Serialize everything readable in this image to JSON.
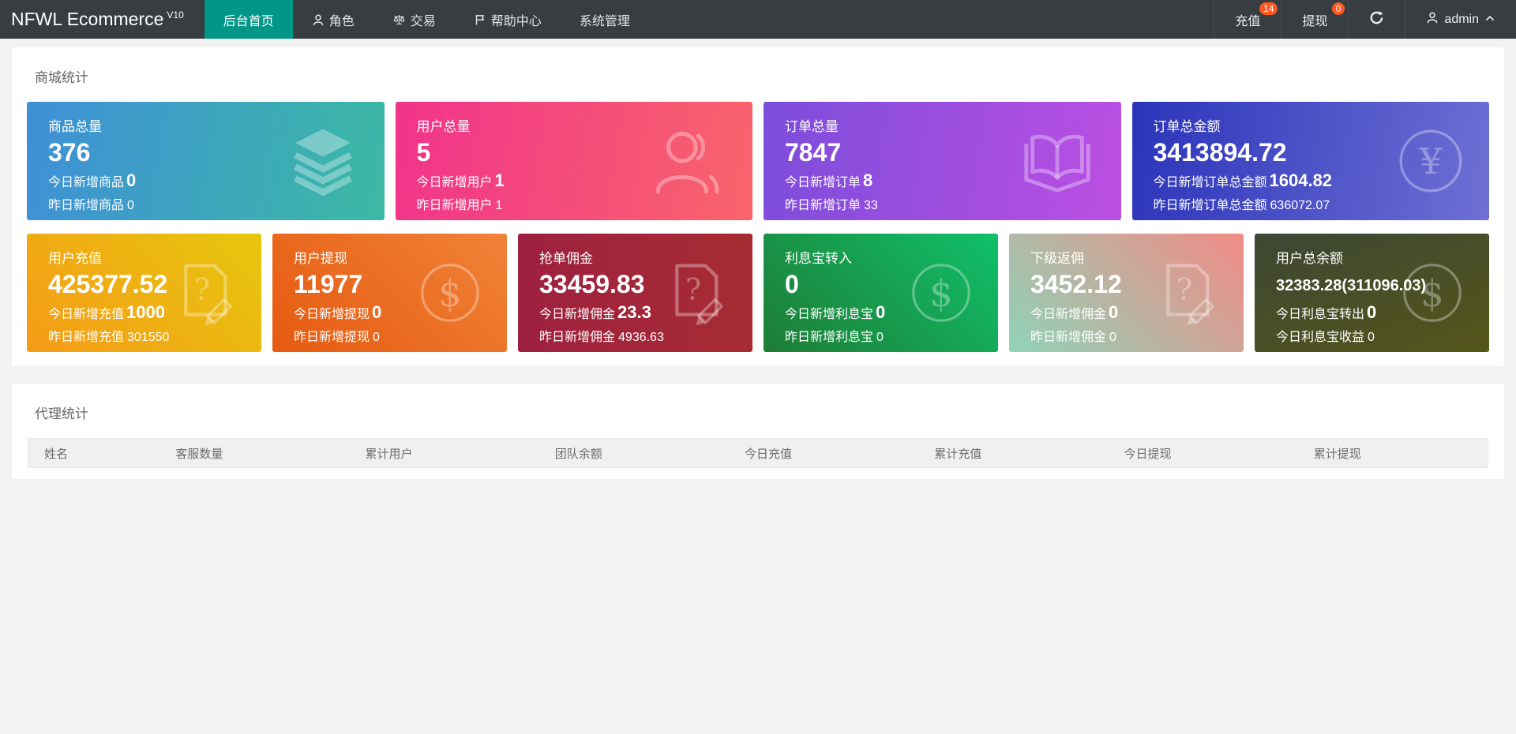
{
  "colors": {
    "navbar_bg": "#373d41",
    "accent_active_tab": "#009688",
    "badge": "#ff5722",
    "page_bg": "#f2f2f2",
    "panel_bg": "#ffffff"
  },
  "navbar": {
    "brand": "NFWL Ecommerce",
    "brand_version": "V10",
    "items": [
      {
        "label": "后台首页",
        "icon": null,
        "active": true
      },
      {
        "label": "角色",
        "icon": "user-icon",
        "active": false
      },
      {
        "label": "交易",
        "icon": "scales-icon",
        "active": false
      },
      {
        "label": "帮助中心",
        "icon": "flag-icon",
        "active": false
      },
      {
        "label": "系统管理",
        "icon": null,
        "active": false
      }
    ],
    "actions": [
      {
        "label": "充值",
        "badge": "14"
      },
      {
        "label": "提现",
        "badge": "0"
      }
    ],
    "refresh_icon": "refresh-icon",
    "user": {
      "name": "admin",
      "icon": "user-icon",
      "chevron": "chevron-up-icon"
    }
  },
  "mall_stats": {
    "title": "商城统计",
    "cards_row1": [
      {
        "title": "商品总量",
        "value": "376",
        "today_label": "今日新增商品",
        "today_value": "0",
        "yesterday_label": "昨日新增商品",
        "yesterday_value": "0",
        "icon": "layers-icon",
        "gradient": {
          "dir": "100deg",
          "from": "#3e90d8",
          "to": "#3cb9a4"
        }
      },
      {
        "title": "用户总量",
        "value": "5",
        "today_label": "今日新增用户",
        "today_value": "1",
        "yesterday_label": "昨日新增用户",
        "yesterday_value": "1",
        "icon": "user-icon",
        "gradient": {
          "dir": "100deg",
          "from": "#f1338b",
          "to": "#f8656a"
        }
      },
      {
        "title": "订单总量",
        "value": "7847",
        "today_label": "今日新增订单",
        "today_value": "8",
        "yesterday_label": "昨日新增订单",
        "yesterday_value": "33",
        "icon": "book-icon",
        "gradient": {
          "dir": "100deg",
          "from": "#7c4ddb",
          "to": "#bb4fe3"
        }
      },
      {
        "title": "订单总金额",
        "value": "3413894.72",
        "today_label": "今日新增订单总金额",
        "today_value": "1604.82",
        "yesterday_label": "昨日新增订单总金额",
        "yesterday_value": "636072.07",
        "icon": "yen-circle-icon",
        "gradient": {
          "dir": "100deg",
          "from": "#2b34ba",
          "to": "#6e70d4"
        }
      }
    ],
    "cards_row2": [
      {
        "title": "用户充值",
        "value": "425377.52",
        "today_label": "今日新增充值",
        "today_value": "1000",
        "yesterday_label": "昨日新增充值",
        "yesterday_value": "301550",
        "icon": "doc-question-icon",
        "gradient": {
          "dir": "45deg",
          "from": "#f59b17",
          "to": "#e7c70e"
        }
      },
      {
        "title": "用户提现",
        "value": "11977",
        "today_label": "今日新增提现",
        "today_value": "0",
        "yesterday_label": "昨日新增提现",
        "yesterday_value": "0",
        "icon": "dollar-circle-icon",
        "gradient": {
          "dir": "45deg",
          "from": "#e55a10",
          "to": "#f08338"
        }
      },
      {
        "title": "抢单佣金",
        "value": "33459.83",
        "today_label": "今日新增佣金",
        "today_value": "23.3",
        "yesterday_label": "昨日新增佣金",
        "yesterday_value": "4936.63",
        "icon": "doc-question-icon",
        "gradient": {
          "dir": "90deg",
          "from": "#9e2040",
          "to": "#a72c32"
        }
      },
      {
        "title": "利息宝转入",
        "value": "0",
        "today_label": "今日新增利息宝",
        "today_value": "0",
        "yesterday_label": "昨日新增利息宝",
        "yesterday_value": "0",
        "icon": "dollar-circle-icon",
        "gradient": {
          "dir": "45deg",
          "from": "#1e7c35",
          "to": "#10c06a"
        }
      },
      {
        "title": "下级返佣",
        "value": "3452.12",
        "today_label": "今日新增佣金",
        "today_value": "0",
        "yesterday_label": "昨日新增佣金",
        "yesterday_value": "0",
        "icon": "doc-question-icon",
        "gradient": {
          "dir": "45deg",
          "from": "#8fd3b8",
          "to": "#f18b85"
        }
      },
      {
        "title": "用户总余额",
        "value": "32383.28(311096.03)",
        "today_label": "今日利息宝转出",
        "today_value": "0",
        "yesterday_label": "今日利息宝收益",
        "yesterday_value": "0",
        "icon": "dollar-circle-icon",
        "gradient": {
          "dir": "160deg",
          "from": "#3c4734",
          "to": "#55561a"
        }
      }
    ]
  },
  "agent_stats": {
    "title": "代理统计",
    "columns": [
      "姓名",
      "客服数量",
      "累计用户",
      "团队余额",
      "今日充值",
      "累计充值",
      "今日提现",
      "累计提现"
    ]
  }
}
